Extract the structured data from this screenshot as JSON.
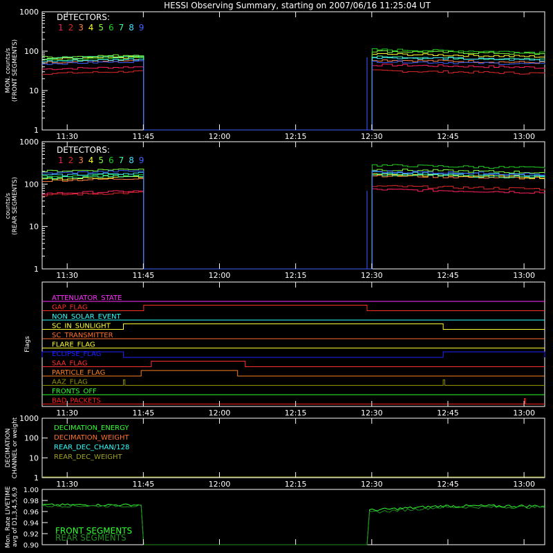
{
  "title": "HESSI Observing Summary, starting on 2007/06/16 11:25:04 UT",
  "time_ticks": [
    "11:30",
    "11:45",
    "12:00",
    "12:15",
    "12:30",
    "12:45",
    "13:00"
  ],
  "colors": {
    "det": [
      "#ff2060",
      "#e02828",
      "#ff8040",
      "#ffff30",
      "#80ff40",
      "#20d020",
      "#40ffa0",
      "#40e0ff",
      "#4060ff"
    ],
    "flags": {
      "attenuator": "#ff30ff",
      "gap": "#ff3020",
      "non_solar": "#30ffff",
      "sunlight": "#ffff30",
      "transmitter": "#ff7030",
      "flare": "#ffff30",
      "eclipse": "#2020ff",
      "saa": "#ff3030",
      "particle": "#ff8020",
      "aaz": "#909000",
      "fronts_off": "#30ff30",
      "bad": "#ff2020"
    }
  },
  "panel1": {
    "ylabel_lines": [
      "MON. counts/s",
      "(FRONT SEGMENTS)"
    ],
    "legend_title": "DETECTORS:",
    "legend_numbers": [
      "1",
      "2",
      "3",
      "4",
      "5",
      "6",
      "7",
      "8",
      "9"
    ],
    "yticks": [
      "1000",
      "100",
      "10",
      "1"
    ]
  },
  "panel2": {
    "ylabel_lines": [
      "counts/s",
      "(REAR SEGMENTS)"
    ],
    "legend_title": "DETECTORS:",
    "legend_numbers": [
      "1",
      "2",
      "3",
      "4",
      "5",
      "6",
      "7",
      "8",
      "9"
    ],
    "yticks": [
      "1000",
      "100",
      "10",
      "1"
    ]
  },
  "panel3": {
    "ylabel": "Flags",
    "flags": [
      {
        "label": "ATTENUATOR_STATE",
        "color_key": "attenuator"
      },
      {
        "label": "GAP_FLAG",
        "color_key": "gap"
      },
      {
        "label": "NON_SOLAR_EVENT",
        "color_key": "non_solar"
      },
      {
        "label": "SC_IN_SUNLIGHT",
        "color_key": "sunlight"
      },
      {
        "label": "SC_TRANSMITTER",
        "color_key": "transmitter"
      },
      {
        "label": "FLARE_FLAG",
        "color_key": "flare"
      },
      {
        "label": "ECLIPSE_FLAG",
        "color_key": "eclipse"
      },
      {
        "label": "SAA_FLAG",
        "color_key": "saa"
      },
      {
        "label": "PARTICLE_FLAG",
        "color_key": "particle"
      },
      {
        "label": "AAZ_FLAG",
        "color_key": "aaz"
      },
      {
        "label": "FRONTS_OFF",
        "color_key": "fronts_off"
      },
      {
        "label": "BAD_PACKETS",
        "color_key": "bad"
      }
    ]
  },
  "panel4": {
    "ylabel_lines": [
      "DECIMATION",
      "CHANNEL or weight"
    ],
    "yticks": [
      "1000",
      "100",
      "10",
      "1"
    ],
    "legend": [
      {
        "label": "DECIMATION_ENERGY",
        "color": "#30ff30"
      },
      {
        "label": "DECIMATION_WEIGHT",
        "color": "#ff7030"
      },
      {
        "label": "REAR_DEC_CHAN/128",
        "color": "#30ffff"
      },
      {
        "label": "REAR_DEC_WEIGHT",
        "color": "#a0a020"
      }
    ]
  },
  "panel5": {
    "ylabel_lines": [
      "Mon. Rate LIVETIME",
      "avg of D1,3,4,5,6,9"
    ],
    "yticks": [
      "1.00",
      "0.98",
      "0.96",
      "0.94",
      "0.92",
      "0.90"
    ],
    "legend": [
      {
        "label": "FRONT SEGMENTS",
        "color": "#30ff30"
      },
      {
        "label": "REAR SEGMENTS",
        "color": "#209020"
      }
    ]
  },
  "chart_data": [
    {
      "type": "line",
      "title": "HESSI Observing Summary, starting on 2007/06/16 11:25:04 UT",
      "ylabel": "MON. counts/s (FRONT SEGMENTS)",
      "yscale": "log",
      "ylim": [
        1,
        1000
      ],
      "x_unit": "minutes after 11:25:04 UT",
      "xlim": [
        0,
        99
      ],
      "gap_minutes": [
        20,
        64
      ],
      "series": [
        {
          "name": "1",
          "before": 35,
          "after": 45
        },
        {
          "name": "2",
          "before": 27,
          "after": 32
        },
        {
          "name": "3",
          "before": 52,
          "after": 60
        },
        {
          "name": "4",
          "before": 62,
          "after": 85
        },
        {
          "name": "5",
          "before": 70,
          "after": 100
        },
        {
          "name": "6",
          "before": 58,
          "after": 110
        },
        {
          "name": "7",
          "before": 65,
          "after": 72
        },
        {
          "name": "8",
          "before": 55,
          "after": 70
        },
        {
          "name": "9",
          "before": 48,
          "after": 55
        }
      ]
    },
    {
      "type": "line",
      "ylabel": "counts/s (REAR SEGMENTS)",
      "yscale": "log",
      "ylim": [
        1,
        1000
      ],
      "x_unit": "minutes after 11:25:04 UT",
      "xlim": [
        0,
        99
      ],
      "gap_minutes": [
        20,
        64
      ],
      "series": [
        {
          "name": "1",
          "before": 60,
          "after": 75
        },
        {
          "name": "2",
          "before": 55,
          "after": 90
        },
        {
          "name": "3",
          "before": 120,
          "after": 160
        },
        {
          "name": "4",
          "before": 130,
          "after": 170
        },
        {
          "name": "5",
          "before": 200,
          "after": 220
        },
        {
          "name": "6",
          "before": 150,
          "after": 280
        },
        {
          "name": "7",
          "before": 140,
          "after": 170
        },
        {
          "name": "8",
          "before": 160,
          "after": 190
        },
        {
          "name": "9",
          "before": 180,
          "after": 200
        }
      ]
    },
    {
      "type": "line",
      "ylabel": "Flags",
      "x_unit": "minutes after 11:25:04 UT",
      "xlim": [
        0,
        99
      ],
      "series": [
        {
          "name": "ATTENUATOR_STATE",
          "on_intervals": []
        },
        {
          "name": "GAP_FLAG",
          "on_intervals": [
            [
              20,
              64
            ]
          ]
        },
        {
          "name": "NON_SOLAR_EVENT",
          "on_intervals": []
        },
        {
          "name": "SC_IN_SUNLIGHT",
          "on_intervals": [
            [
              16,
              79
            ]
          ]
        },
        {
          "name": "SC_TRANSMITTER",
          "on_intervals": []
        },
        {
          "name": "FLARE_FLAG",
          "on_intervals": []
        },
        {
          "name": "ECLIPSE_FLAG",
          "on_intervals": [
            [
              0,
              16
            ],
            [
              79,
              99
            ]
          ]
        },
        {
          "name": "SAA_FLAG",
          "on_intervals": [
            [
              21.5,
              40
            ]
          ]
        },
        {
          "name": "PARTICLE_FLAG",
          "on_intervals": [
            [
              19.5,
              38.5
            ]
          ]
        },
        {
          "name": "AAZ_FLAG",
          "on_intervals": [
            [
              16,
              16.3
            ],
            [
              79,
              79.3
            ]
          ]
        },
        {
          "name": "FRONTS_OFF",
          "on_intervals": []
        },
        {
          "name": "BAD_PACKETS",
          "on_intervals": [
            [
              95,
              95.2
            ]
          ]
        }
      ]
    },
    {
      "type": "line",
      "ylabel": "DECIMATION CHANNEL or weight",
      "yscale": "log",
      "ylim": [
        1,
        1000
      ],
      "series": [
        {
          "name": "DECIMATION_ENERGY",
          "value": 1
        },
        {
          "name": "DECIMATION_WEIGHT",
          "value": 1
        },
        {
          "name": "REAR_DEC_CHAN/128",
          "value": 1
        },
        {
          "name": "REAR_DEC_WEIGHT",
          "value": 1
        }
      ]
    },
    {
      "type": "line",
      "ylabel": "Mon. Rate LIVETIME avg of D1,3,4,5,6,9",
      "ylim": [
        0.9,
        1.0
      ],
      "x_unit": "minutes after 11:25:04 UT",
      "xlim": [
        0,
        99
      ],
      "gap_minutes": [
        20,
        64
      ],
      "series": [
        {
          "name": "FRONT SEGMENTS",
          "before": 0.972,
          "after_start": 0.962,
          "after_end": 0.97
        },
        {
          "name": "REAR SEGMENTS",
          "before": 0.97,
          "after_start": 0.958,
          "after_end": 0.968
        }
      ]
    }
  ]
}
